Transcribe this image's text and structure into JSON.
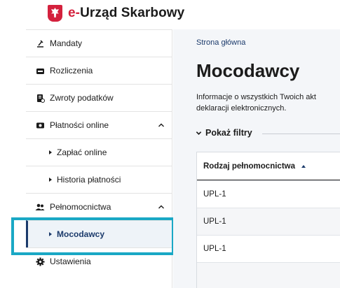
{
  "header": {
    "brand_prefix": "e-",
    "brand_name": "Urząd Skarbowy"
  },
  "sidebar": {
    "items": [
      {
        "label": "Mandaty",
        "icon": "fine-icon"
      },
      {
        "label": "Rozliczenia",
        "icon": "wallet-icon"
      },
      {
        "label": "Zwroty podatków",
        "icon": "refund-icon"
      },
      {
        "label": "Płatności online",
        "icon": "payment-card-icon",
        "expanded": true
      },
      {
        "label": "Zapłać online",
        "icon": "triangle-bullet-icon"
      },
      {
        "label": "Historia płatności",
        "icon": "triangle-bullet-icon"
      },
      {
        "label": "Pełnomocnictwa",
        "icon": "people-icon",
        "expanded": true
      },
      {
        "label": "Mocodawcy",
        "icon": "triangle-bullet-icon",
        "active": true
      },
      {
        "label": "Ustawienia",
        "icon": "gear-icon"
      }
    ]
  },
  "main": {
    "breadcrumb": "Strona główna",
    "title": "Mocodawcy",
    "description_line1": "Informacje o wszystkich Twoich akt",
    "description_line2": "deklaracji elektronicznych.",
    "filters_label": "Pokaż filtry",
    "table": {
      "column_header": "Rodzaj pełnomocnictwa",
      "rows": [
        "UPL-1",
        "UPL-1",
        "UPL-1"
      ]
    }
  },
  "colors": {
    "accent": "#1b3a6b",
    "highlight": "#1aa8c5",
    "brand_red": "#d4213d"
  }
}
